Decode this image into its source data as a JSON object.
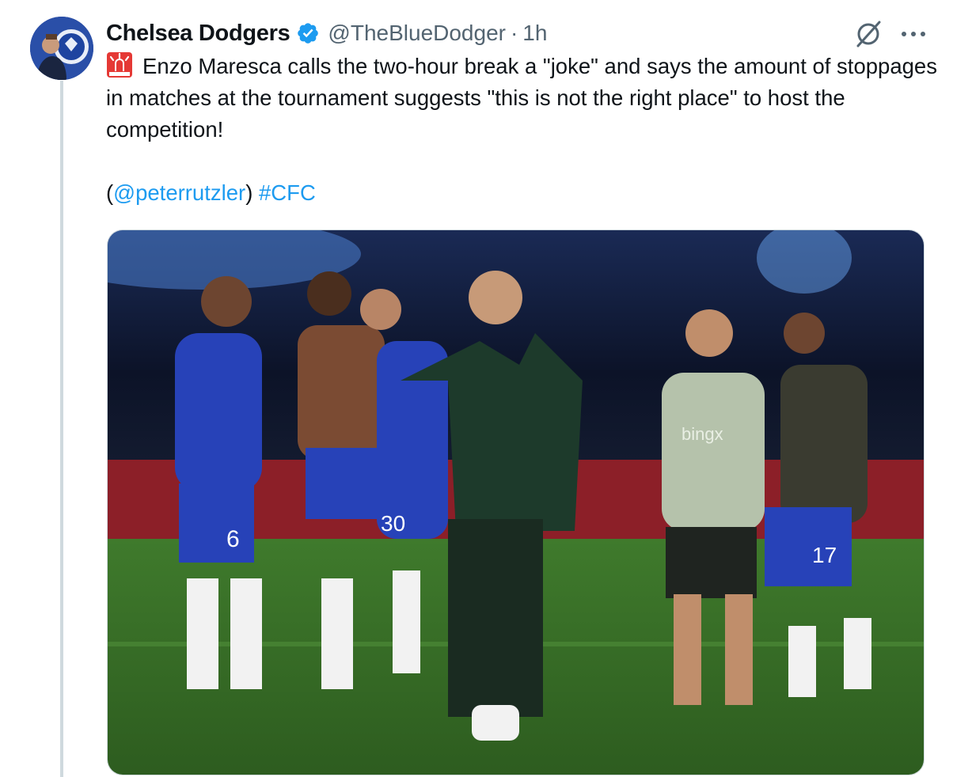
{
  "tweet": {
    "display_name": "Chelsea Dodgers",
    "handle": "@TheBlueDodger",
    "separator": "·",
    "time": "1h",
    "verified": true,
    "text_line1": "Enzo Maresca calls the two-hour break a \"joke\" and says the amount of stoppages in matches at the tournament suggests \"this is not the right place\" to host the competition!",
    "open_paren": "(",
    "mention": "@peterrutzler",
    "close_paren": ")",
    "hashtag": "#CFC",
    "emoji_icon": "police-light-icon",
    "media_icon": "photo",
    "kit_numbers": [
      "6",
      "30",
      "17"
    ],
    "shirt_sponsor": "bingx"
  },
  "colors": {
    "accent": "#1d9bf0",
    "text": "#0f1419",
    "secondary": "#536471",
    "border": "#cfd9de"
  }
}
